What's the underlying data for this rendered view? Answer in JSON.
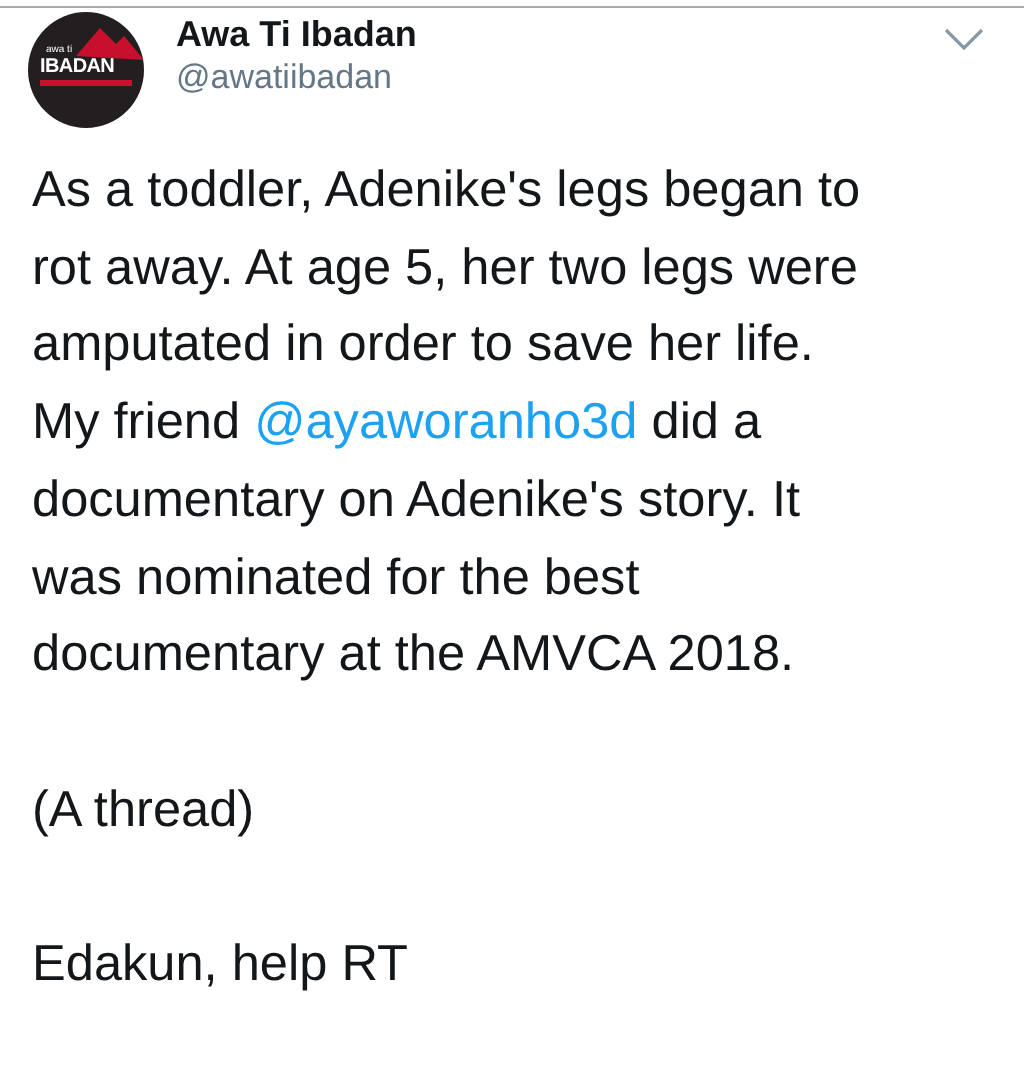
{
  "account": {
    "name": "Awa Ti Ibadan",
    "handle": "@awatiibadan",
    "logo": {
      "small": "awa ti",
      "main": "IBADAN"
    }
  },
  "paragraphs": [
    {
      "parts": [
        {
          "kind": "text",
          "text": "As a toddler, Adenike's legs began to\nrot away. At age 5, her two legs were\namputated in order to save her life.\nMy friend "
        },
        {
          "kind": "mention",
          "text": "@ayaworanho3d"
        },
        {
          "kind": "text",
          "text": " did a\ndocumentary on Adenike's story. It\nwas nominated for the best\ndocumentary at the AMVCA 2018."
        }
      ]
    },
    {
      "parts": [
        {
          "kind": "text",
          "text": "(A thread)"
        }
      ]
    },
    {
      "parts": [
        {
          "kind": "text",
          "text": "Edakun, help RT"
        }
      ]
    }
  ]
}
